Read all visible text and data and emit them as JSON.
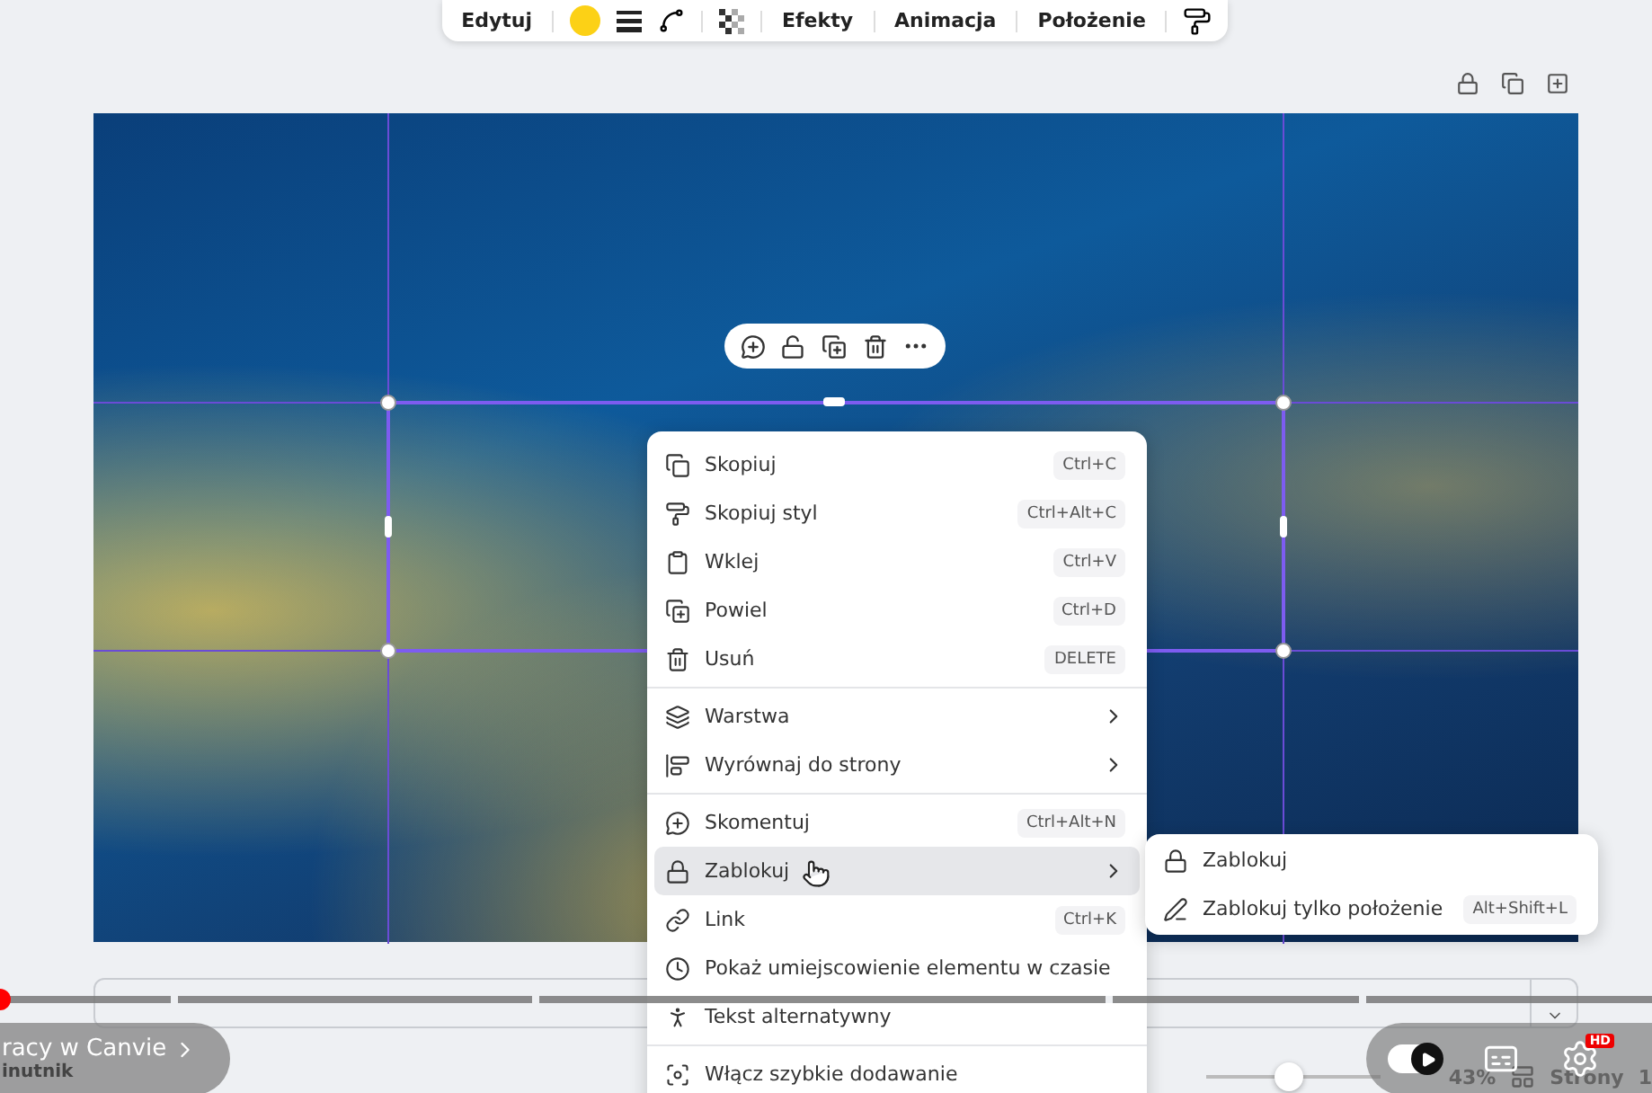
{
  "toolbar": {
    "edit": "Edytuj",
    "tabs": [
      "Efekty",
      "Animacja",
      "Położenie"
    ]
  },
  "context_menu": {
    "sections": [
      [
        {
          "label": "Skopiuj",
          "shortcut": "Ctrl+C",
          "has_submenu": false,
          "hovered": false
        },
        {
          "label": "Skopiuj styl",
          "shortcut": "Ctrl+Alt+C",
          "has_submenu": false,
          "hovered": false
        },
        {
          "label": "Wklej",
          "shortcut": "Ctrl+V",
          "has_submenu": false,
          "hovered": false
        },
        {
          "label": "Powiel",
          "shortcut": "Ctrl+D",
          "has_submenu": false,
          "hovered": false
        },
        {
          "label": "Usuń",
          "shortcut": "DELETE",
          "has_submenu": false,
          "hovered": false
        }
      ],
      [
        {
          "label": "Warstwa",
          "has_submenu": true,
          "hovered": false
        },
        {
          "label": "Wyrównaj do strony",
          "has_submenu": true,
          "hovered": false
        }
      ],
      [
        {
          "label": "Skomentuj",
          "shortcut": "Ctrl+Alt+N",
          "has_submenu": false,
          "hovered": false
        },
        {
          "label": "Zablokuj",
          "has_submenu": true,
          "hovered": true
        },
        {
          "label": "Link",
          "shortcut": "Ctrl+K",
          "has_submenu": false,
          "hovered": false
        },
        {
          "label": "Pokaż umiejscowienie elementu w czasie",
          "has_submenu": false,
          "hovered": false
        },
        {
          "label": "Tekst alternatywny",
          "has_submenu": false,
          "hovered": false
        }
      ],
      [
        {
          "label": "Włącz szybkie dodawanie",
          "has_submenu": false,
          "hovered": false
        }
      ]
    ]
  },
  "submenu": {
    "items": [
      {
        "label": "Zablokuj"
      },
      {
        "label": "Zablokuj tylko położenie",
        "shortcut": "Alt+Shift+L"
      }
    ]
  },
  "video_overlay": {
    "chapter_title": "racy w Canvie",
    "chapter_subtitle": "inutnik",
    "hd_badge": "HD",
    "progress": {
      "level": 0
    },
    "autoplay": {
      "on": true
    }
  },
  "footer": {
    "zoom_slider": {
      "level": 0.48
    },
    "zoom": "43%",
    "pages": "Strony",
    "page_number": "1"
  }
}
